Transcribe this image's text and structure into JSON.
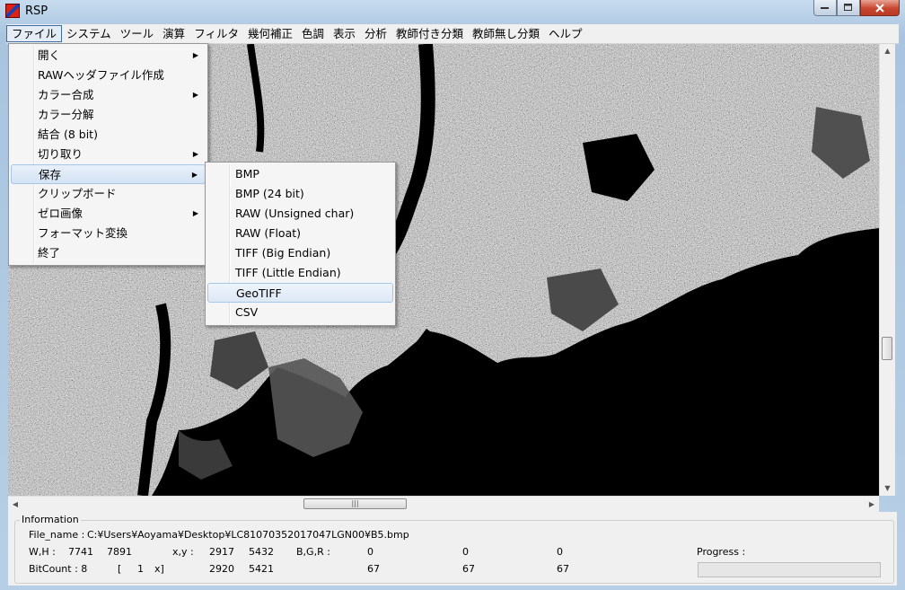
{
  "window": {
    "title": "RSP",
    "controls": [
      "minimize",
      "maximize",
      "close"
    ]
  },
  "menubar": [
    "ファイル",
    "システム",
    "ツール",
    "演算",
    "フィルタ",
    "幾何補正",
    "色調",
    "表示",
    "分析",
    "教師付き分類",
    "教師無し分類",
    "ヘルプ"
  ],
  "file_menu": [
    {
      "label": "開く",
      "submenu": true
    },
    {
      "label": "RAWヘッダファイル作成",
      "submenu": false
    },
    {
      "label": "カラー合成",
      "submenu": true
    },
    {
      "label": "カラー分解",
      "submenu": false
    },
    {
      "label": "結合 (8 bit)",
      "submenu": false
    },
    {
      "label": "切り取り",
      "submenu": true
    },
    {
      "label": "保存",
      "submenu": true
    },
    {
      "label": "クリップボード",
      "submenu": false
    },
    {
      "label": "ゼロ画像",
      "submenu": true
    },
    {
      "label": "フォーマット変換",
      "submenu": false
    },
    {
      "label": "終了",
      "submenu": false
    }
  ],
  "save_submenu": [
    "BMP",
    "BMP (24 bit)",
    "RAW (Unsigned char)",
    "RAW (Float)",
    "TIFF (Big Endian)",
    "TIFF (Little Endian)",
    "GeoTIFF",
    "CSV"
  ],
  "info": {
    "legend": "Information",
    "file_label": "File_name :",
    "file_value": "C:¥Users¥Aoyama¥Desktop¥LC81070352017047LGN00¥B5.bmp",
    "wh_label": "W,H :",
    "w": "7741",
    "h": "7891",
    "xy_label": "x,y :",
    "x1": "2917",
    "y1": "5432",
    "x2": "2920",
    "y2": "5421",
    "bgr_label": "B,G,R :",
    "b1": "0",
    "g1": "0",
    "r1": "0",
    "b2": "67",
    "g2": "67",
    "r2": "67",
    "bitcount_label": "BitCount : 8",
    "zoom_open": "[",
    "zoom_value": "1",
    "zoom_close": "x]",
    "progress_label": "Progress :",
    "progress_value": 0
  }
}
